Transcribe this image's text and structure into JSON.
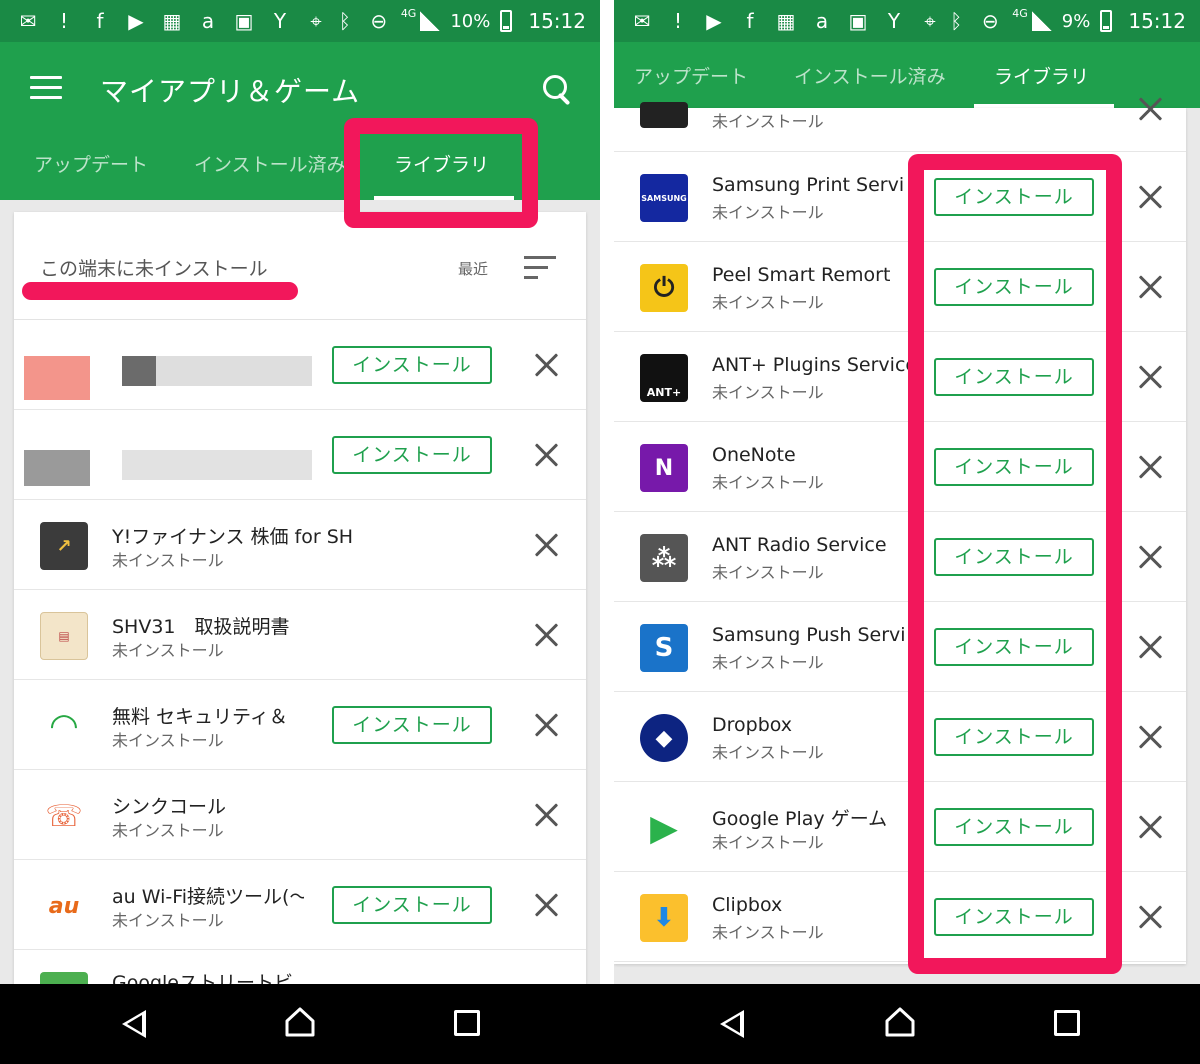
{
  "left": {
    "status_bar": {
      "battery": "10%",
      "network": "4G",
      "time": "15:12"
    },
    "app_title": "マイアプリ＆ゲーム",
    "tabs": [
      "アップデート",
      "インストール済み",
      "ライブラリ"
    ],
    "active_tab": "ライブラリ",
    "section_title": "この端末に未インストール",
    "sort_label": "最近",
    "rows": [
      {
        "name": "",
        "status": "",
        "install": "インストール",
        "blurred": true
      },
      {
        "name": "",
        "status": "",
        "install": "インストール",
        "blurred": true
      },
      {
        "name": "Y!ファイナンス 株価 for SH",
        "status": "未インストール",
        "install": ""
      },
      {
        "name": "SHV31　取扱説明書",
        "status": "未インストール",
        "install": ""
      },
      {
        "name": "無料 セキュリティ＆",
        "status": "未インストール",
        "install": "インストール"
      },
      {
        "name": "シンクコール",
        "status": "未インストール",
        "install": ""
      },
      {
        "name": "au Wi-Fi接続ツール(〜",
        "status": "未インストール",
        "install": "インストール"
      },
      {
        "name": "Googleストリートビ",
        "status": "",
        "install": ""
      }
    ]
  },
  "right": {
    "status_bar": {
      "battery": "9%",
      "network": "4G",
      "time": "15:12"
    },
    "tabs": [
      "アップデート",
      "インストール済み",
      "ライブラリ"
    ],
    "active_tab": "ライブラリ",
    "top_partial_status": "未インストール",
    "rows": [
      {
        "name": "Samsung Print Servic",
        "status": "未インストール",
        "install": "インストール",
        "icon_text": "SAMSUNG"
      },
      {
        "name": "Peel Smart Remort",
        "status": "未インストール",
        "install": "インストール",
        "icon_text": ""
      },
      {
        "name": "ANT+ Plugins Service",
        "status": "未インストール",
        "install": "インストール",
        "icon_text": "ANT+"
      },
      {
        "name": "OneNote",
        "status": "未インストール",
        "install": "インストール",
        "icon_text": "N"
      },
      {
        "name": "ANT Radio Service",
        "status": "未インストール",
        "install": "インストール",
        "icon_text": ""
      },
      {
        "name": "Samsung Push Servic",
        "status": "未インストール",
        "install": "インストール",
        "icon_text": "S"
      },
      {
        "name": "Dropbox",
        "status": "未インストール",
        "install": "インストール",
        "icon_text": ""
      },
      {
        "name": "Google Play ゲーム",
        "status": "未インストール",
        "install": "インストール",
        "icon_text": ""
      },
      {
        "name": "Clipbox",
        "status": "未インストール",
        "install": "インストール",
        "icon_text": ""
      }
    ]
  },
  "colors": {
    "status_bar": "#1a8a45",
    "app_bar": "#1fa04d",
    "accent_green": "#1fa04d",
    "highlight_pink": "#f2175b"
  }
}
